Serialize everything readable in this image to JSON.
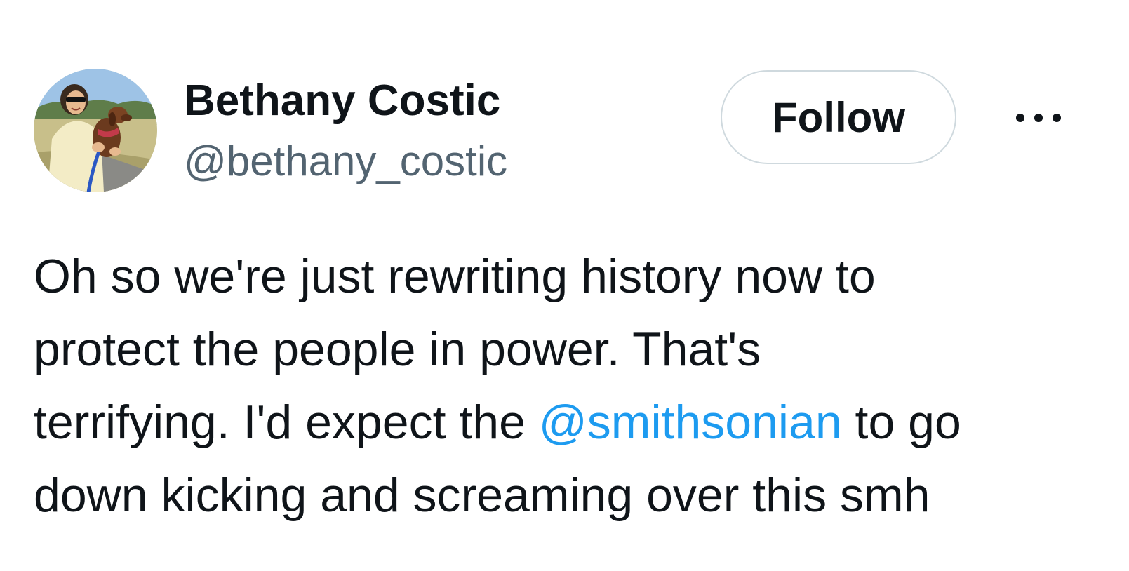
{
  "author": {
    "display_name": "Bethany Costic",
    "handle": "@bethany_costic",
    "avatar_icon": "profile-photo-woman-with-dog"
  },
  "actions": {
    "follow_label": "Follow",
    "more_icon": "more-horizontal-icon"
  },
  "tweet": {
    "lines": [
      {
        "text": "Oh so we're just rewriting history now to"
      },
      {
        "text": "protect the people in power. That's"
      },
      {
        "before": "terrifying. I'd expect the ",
        "mention": "@smithsonian",
        "after": " to go"
      },
      {
        "text": "down kicking and screaming over this smh"
      }
    ]
  },
  "colors": {
    "text": "#0f1419",
    "secondary": "#536471",
    "mention": "#1d9bf0",
    "border": "#cfd9de"
  }
}
